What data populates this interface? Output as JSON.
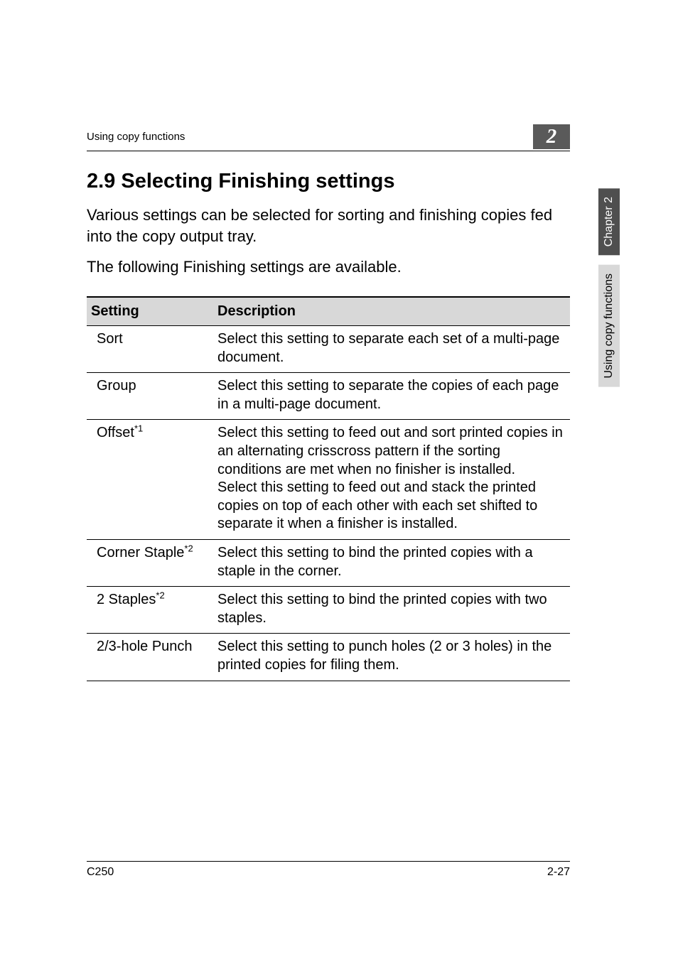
{
  "header": {
    "running_head": "Using copy functions",
    "chapter_box": "2"
  },
  "section": {
    "title": "2.9    Selecting Finishing settings",
    "intro_line1": "Various settings can be selected for sorting and finishing copies fed into the copy output tray.",
    "intro_line2": "The following Finishing settings are available."
  },
  "table": {
    "head_setting": "Setting",
    "head_description": "Description",
    "rows": [
      {
        "setting": "Sort",
        "sup": "",
        "description": "Select this setting to separate each set of a multi-page document."
      },
      {
        "setting": "Group",
        "sup": "",
        "description": "Select this setting to separate the copies of each page in a multi-page document."
      },
      {
        "setting": "Offset",
        "sup": "*1",
        "description": "Select this setting to feed out and sort printed copies in an alternating crisscross pattern if the sorting conditions are met when no finisher is installed.\nSelect this setting to feed out and stack the printed copies on top of each other with each set shifted to separate it when a finisher is installed."
      },
      {
        "setting": "Corner Staple",
        "sup": "*2",
        "description": "Select this setting to bind the printed copies with a staple in the corner."
      },
      {
        "setting": "2 Staples",
        "sup": "*2",
        "description": "Select this setting to bind the printed copies with two staples."
      },
      {
        "setting": "2/3-hole Punch",
        "sup": "",
        "description": "Select this setting to punch holes (2 or 3 holes) in the printed copies for filing them."
      }
    ]
  },
  "side_tabs": {
    "dark": "Chapter 2",
    "light": "Using copy functions"
  },
  "footer": {
    "model": "C250",
    "page": "2-27"
  }
}
